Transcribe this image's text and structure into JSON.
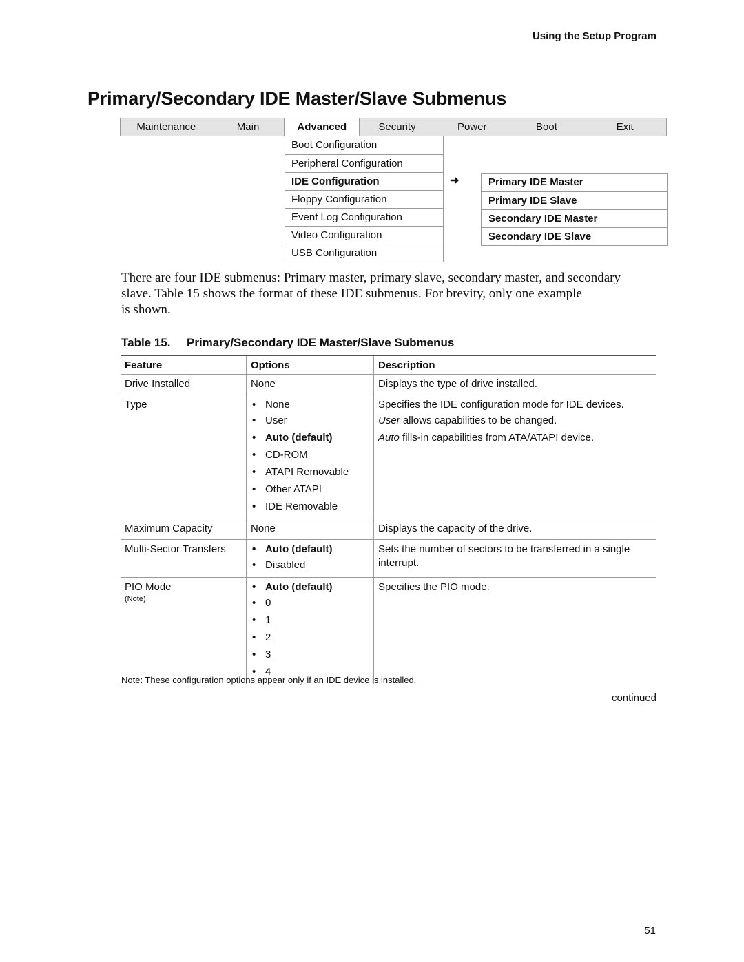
{
  "header": {
    "section": "Using the Setup Program"
  },
  "page_title": "Primary/Secondary IDE Master/Slave Submenus",
  "menubar": {
    "tabs": [
      {
        "label": "Maintenance",
        "active": false
      },
      {
        "label": "Main",
        "active": false
      },
      {
        "label": "Advanced",
        "active": true
      },
      {
        "label": "Security",
        "active": false
      },
      {
        "label": "Power",
        "active": false
      },
      {
        "label": "Boot",
        "active": false
      },
      {
        "label": "Exit",
        "active": false
      }
    ]
  },
  "advanced_menu": {
    "items": [
      {
        "label": "Boot Configuration"
      },
      {
        "label": "Peripheral Configuration"
      },
      {
        "label": "IDE Configuration",
        "selected": true
      },
      {
        "label": "Floppy Configuration"
      },
      {
        "label": "Event Log Configuration"
      },
      {
        "label": "Video Configuration"
      },
      {
        "label": "USB Configuration"
      }
    ],
    "arrow": "➜"
  },
  "ide_submenu": {
    "items": [
      {
        "label": "Primary IDE Master"
      },
      {
        "label": "Primary IDE Slave"
      },
      {
        "label": "Secondary IDE Master"
      },
      {
        "label": "Secondary IDE Slave"
      }
    ]
  },
  "paragraph": {
    "lines": [
      "There are four IDE submenus:  Primary master, primary slave, secondary master, and secondary",
      "slave.  Table 15 shows the format of these IDE submenus.  For brevity, only one example",
      "is shown."
    ]
  },
  "table": {
    "caption_number": "Table 15.",
    "caption_title": "Primary/Secondary IDE Master/Slave Submenus",
    "headers": [
      "Feature",
      "Options",
      "Description"
    ],
    "rows": [
      {
        "feature": "Drive Installed",
        "options": [
          {
            "text": "None",
            "plain": true
          }
        ],
        "description": [
          {
            "text": "Displays the type of drive installed."
          }
        ]
      },
      {
        "feature": "Type",
        "options": [
          {
            "text": "None"
          },
          {
            "text": "User"
          },
          {
            "text": "Auto (default)",
            "default": true
          },
          {
            "text": "CD-ROM"
          },
          {
            "text": "ATAPI Removable"
          },
          {
            "text": "Other ATAPI"
          },
          {
            "text": "IDE Removable"
          }
        ],
        "description": [
          {
            "text": "Specifies the IDE configuration mode for IDE devices."
          },
          {
            "italic": "User",
            "text": " allows capabilities to be changed."
          },
          {
            "italic": "Auto",
            "text": " fills-in capabilities from ATA/ATAPI device."
          }
        ]
      },
      {
        "feature": "Maximum Capacity",
        "options": [
          {
            "text": "None",
            "plain": true
          }
        ],
        "description": [
          {
            "text": "Displays the capacity of the drive."
          }
        ]
      },
      {
        "feature": "Multi-Sector Transfers",
        "options": [
          {
            "text": "Auto (default)",
            "default": true
          },
          {
            "text": "Disabled"
          }
        ],
        "description": [
          {
            "text": "Sets the number of sectors to be transferred in a single interrupt."
          }
        ]
      },
      {
        "feature": "PIO Mode",
        "feature_note": "(Note)",
        "options": [
          {
            "text": "Auto (default)",
            "default": true
          },
          {
            "text": "0"
          },
          {
            "text": "1"
          },
          {
            "text": "2"
          },
          {
            "text": "3"
          },
          {
            "text": "4"
          }
        ],
        "description": [
          {
            "text": "Specifies the PIO mode."
          }
        ]
      }
    ]
  },
  "note": "Note:  These configuration options appear only if an IDE device is installed.",
  "continued": "continued",
  "page_number": "51"
}
